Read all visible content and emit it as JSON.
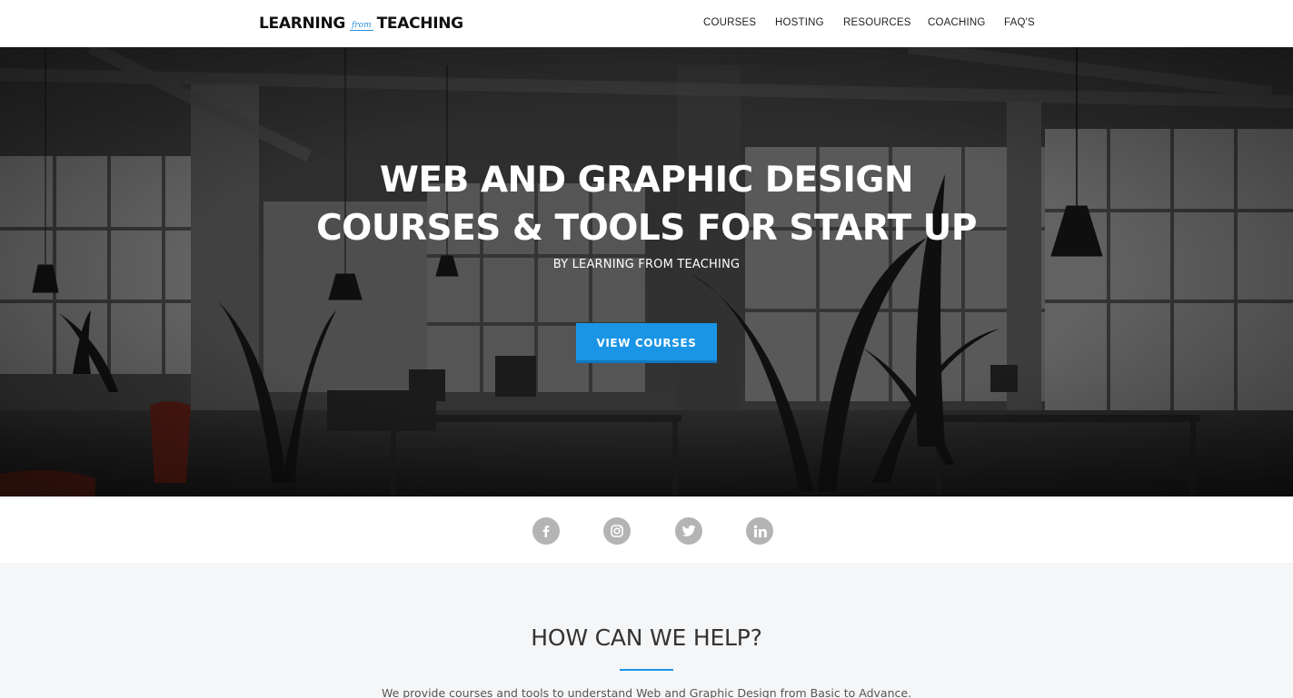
{
  "header": {
    "logo": {
      "part1": "LEARNING",
      "part2": "from",
      "part3": "TEACHING"
    },
    "nav": [
      {
        "label": "COURSES"
      },
      {
        "label": "HOSTING"
      },
      {
        "label": "RESOURCES"
      },
      {
        "label": "COACHING"
      },
      {
        "label": "FAQ'S"
      }
    ]
  },
  "hero": {
    "title_line1": "WEB AND GRAPHIC DESIGN",
    "title_line2": "COURSES & TOOLS FOR START UP",
    "subtitle": "BY LEARNING FROM TEACHING",
    "cta_label": "VIEW COURSES"
  },
  "social": [
    {
      "icon": "facebook-icon"
    },
    {
      "icon": "instagram-icon"
    },
    {
      "icon": "twitter-icon"
    },
    {
      "icon": "linkedin-icon"
    }
  ],
  "help": {
    "heading": "HOW CAN WE HELP?",
    "text": "We provide courses and tools to understand Web and Graphic Design from Basic to Advance."
  },
  "colors": {
    "accent": "#1a95e6",
    "social_icon_bg": "#b4b4b4",
    "section_bg": "#f5f6f7"
  }
}
